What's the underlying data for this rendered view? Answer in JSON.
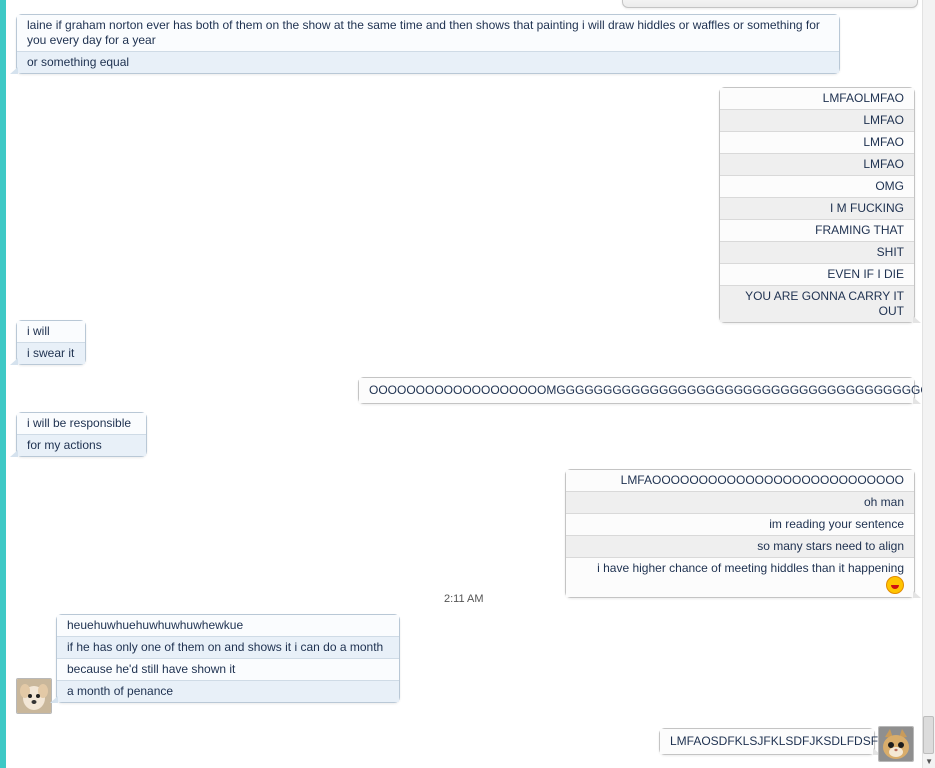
{
  "timestamp": "2:11 AM",
  "messages": {
    "m1": [
      "laine if graham norton ever has both of them on the show at the same time and then shows that painting i will draw hiddles or waffles or something for you every day for a year",
      "or something equal"
    ],
    "m2": [
      "LMFAOLMFAO",
      "LMFAO",
      "LMFAO",
      "LMFAO",
      "OMG",
      "I M FUCKING",
      "FRAMING THAT",
      "SHIT",
      "EVEN IF I DIE",
      "YOU ARE GONNA CARRY IT OUT"
    ],
    "m3": [
      "i will",
      "i swear it"
    ],
    "m4": [
      "OOOOOOOOOOOOOOOOOOOMGGGGGGGGGGGGGGGGGGGGGGGGGGGGGGGGGGGGGGGGGGG"
    ],
    "m5": [
      "i will be responsible",
      "for my actions"
    ],
    "m6": [
      "LMFAOOOOOOOOOOOOOOOOOOOOOOOOOOO",
      "oh man",
      "im reading your sentence",
      "so many stars need to align",
      "i have higher chance of meeting hiddles than it happening"
    ],
    "m7": [
      "heuehuwhuehuwhuwhuwhewkue",
      "if he has only one of them on and shows it i can do a month",
      "because he'd still have shown it",
      "a month of penance"
    ],
    "m8": [
      "LMFAOSDFKLSJFKLSDFJKSDLFDSFDD"
    ]
  },
  "colors": {
    "accent": "#3ec9c6",
    "text": "#1e3150"
  },
  "icons": {
    "reaction": "tongue-out-emoji-icon",
    "avatar_left": "puppy-avatar-icon",
    "avatar_right": "cat-avatar-icon"
  }
}
